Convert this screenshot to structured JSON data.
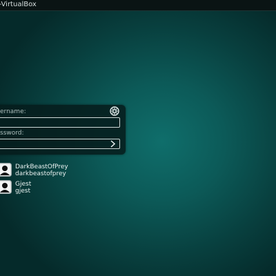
{
  "window": {
    "title": "ly-VirtualBox"
  },
  "login": {
    "username_label": "ername:",
    "username_value": "",
    "password_label": "ssword:",
    "password_value": ""
  },
  "icons": {
    "settings": "gear-icon",
    "submit": "chevron-right-icon",
    "avatar": "user-avatar-icon"
  },
  "users": [
    {
      "name": "DarkBeastOfPrey",
      "login": "darkbeastofprey"
    },
    {
      "name": "Gjest",
      "login": "gjest"
    }
  ],
  "colors": {
    "background": "#0c5a58",
    "panel": "#061c1c",
    "text": "#e8f0ef"
  }
}
